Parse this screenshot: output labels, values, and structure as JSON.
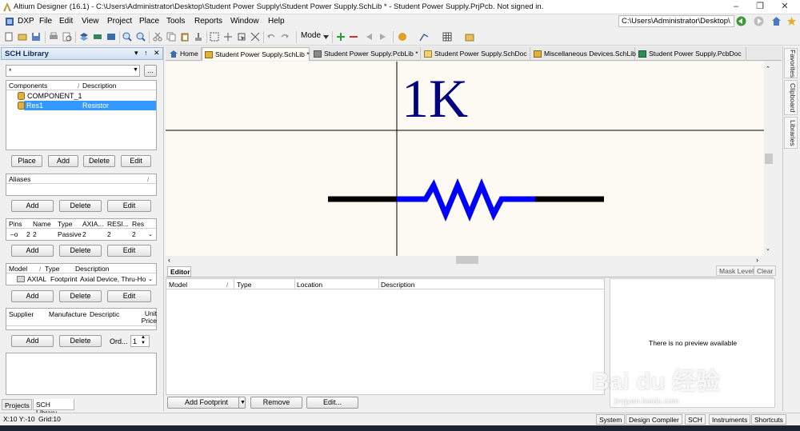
{
  "window": {
    "title": "Altium Designer (16.1) - C:\\Users\\Administrator\\Desktop\\Student Power Supply\\Student Power Supply.SchLib * - Student Power Supply.PrjPcb. Not signed in."
  },
  "menu": {
    "items": [
      "DXP",
      "File",
      "Edit",
      "View",
      "Project",
      "Place",
      "Tools",
      "Reports",
      "Window",
      "Help"
    ],
    "path": "C:\\Users\\Administrator\\Desktop\\"
  },
  "toolbar": {
    "mode_label": "Mode"
  },
  "panel": {
    "title": "SCH Library",
    "filter_value": "*",
    "filter_button": "...",
    "components": {
      "headers": [
        "Components",
        "Description"
      ],
      "rows": [
        {
          "name": "COMPONENT_1",
          "description": ""
        },
        {
          "name": "Res1",
          "description": "Resistor"
        }
      ],
      "buttons": [
        "Place",
        "Add",
        "Delete",
        "Edit"
      ]
    },
    "aliases": {
      "header": "Aliases",
      "buttons": [
        "Add",
        "Delete",
        "Edit"
      ]
    },
    "pins": {
      "headers": [
        "Pins",
        "Name",
        "Type",
        "AXIA...",
        "RESI...",
        "Res"
      ],
      "rows": [
        [
          "2",
          "2",
          "Passive",
          "2",
          "2",
          "2"
        ]
      ],
      "buttons": [
        "Add",
        "Delete",
        "Edit"
      ]
    },
    "models": {
      "headers": [
        "Model",
        "Type",
        "Description"
      ],
      "rows": [
        [
          "AXIAL",
          "Footprint",
          "Axial Device, Thru-Hole;"
        ]
      ],
      "buttons": [
        "Add",
        "Delete",
        "Edit"
      ]
    },
    "suppliers": {
      "headers": [
        "Supplier",
        "Manufacture",
        "Descriptic",
        "Unit Price"
      ],
      "buttons": [
        "Add",
        "Delete"
      ],
      "order_label": "Ord...",
      "order_value": "1"
    },
    "bottom_tabs": [
      "Projects",
      "SCH Library"
    ]
  },
  "doc_tabs": [
    {
      "label": "Home",
      "active": false
    },
    {
      "label": "Student Power Supply.SchLib *",
      "active": true
    },
    {
      "label": "Student Power Supply.PcbLib *",
      "active": false
    },
    {
      "label": "Student Power Supply.SchDoc",
      "active": false
    },
    {
      "label": "Miscellaneous Devices.SchLib",
      "active": false
    },
    {
      "label": "Student Power Supply.PcbDoc",
      "active": false
    }
  ],
  "canvas": {
    "component_text": "1K"
  },
  "editor": {
    "tab_label": "Editor",
    "mask_level": "Mask Level",
    "clear": "Clear",
    "headers": [
      "Model",
      "Type",
      "Location",
      "Description"
    ],
    "buttons": {
      "add_footprint": "Add Footprint",
      "remove": "Remove",
      "edit": "Edit..."
    },
    "preview_text": "There is no preview available"
  },
  "right_tabs": [
    "Favorites",
    "Clipboard",
    "Libraries"
  ],
  "status": {
    "coords": "X:10 Y:-10",
    "grid": "Grid:10",
    "buttons": [
      "System",
      "Design Compiler",
      "SCH",
      "Instruments",
      "Shortcuts"
    ]
  },
  "watermark": {
    "main": "Bai du 经验",
    "url": "jingyan.baidu.com"
  },
  "colors": {
    "pin_wire": "#000000",
    "resistor": "#0000ff",
    "text": "#000080",
    "canvas": "#fdfaf3",
    "selection": "#3399ff"
  }
}
